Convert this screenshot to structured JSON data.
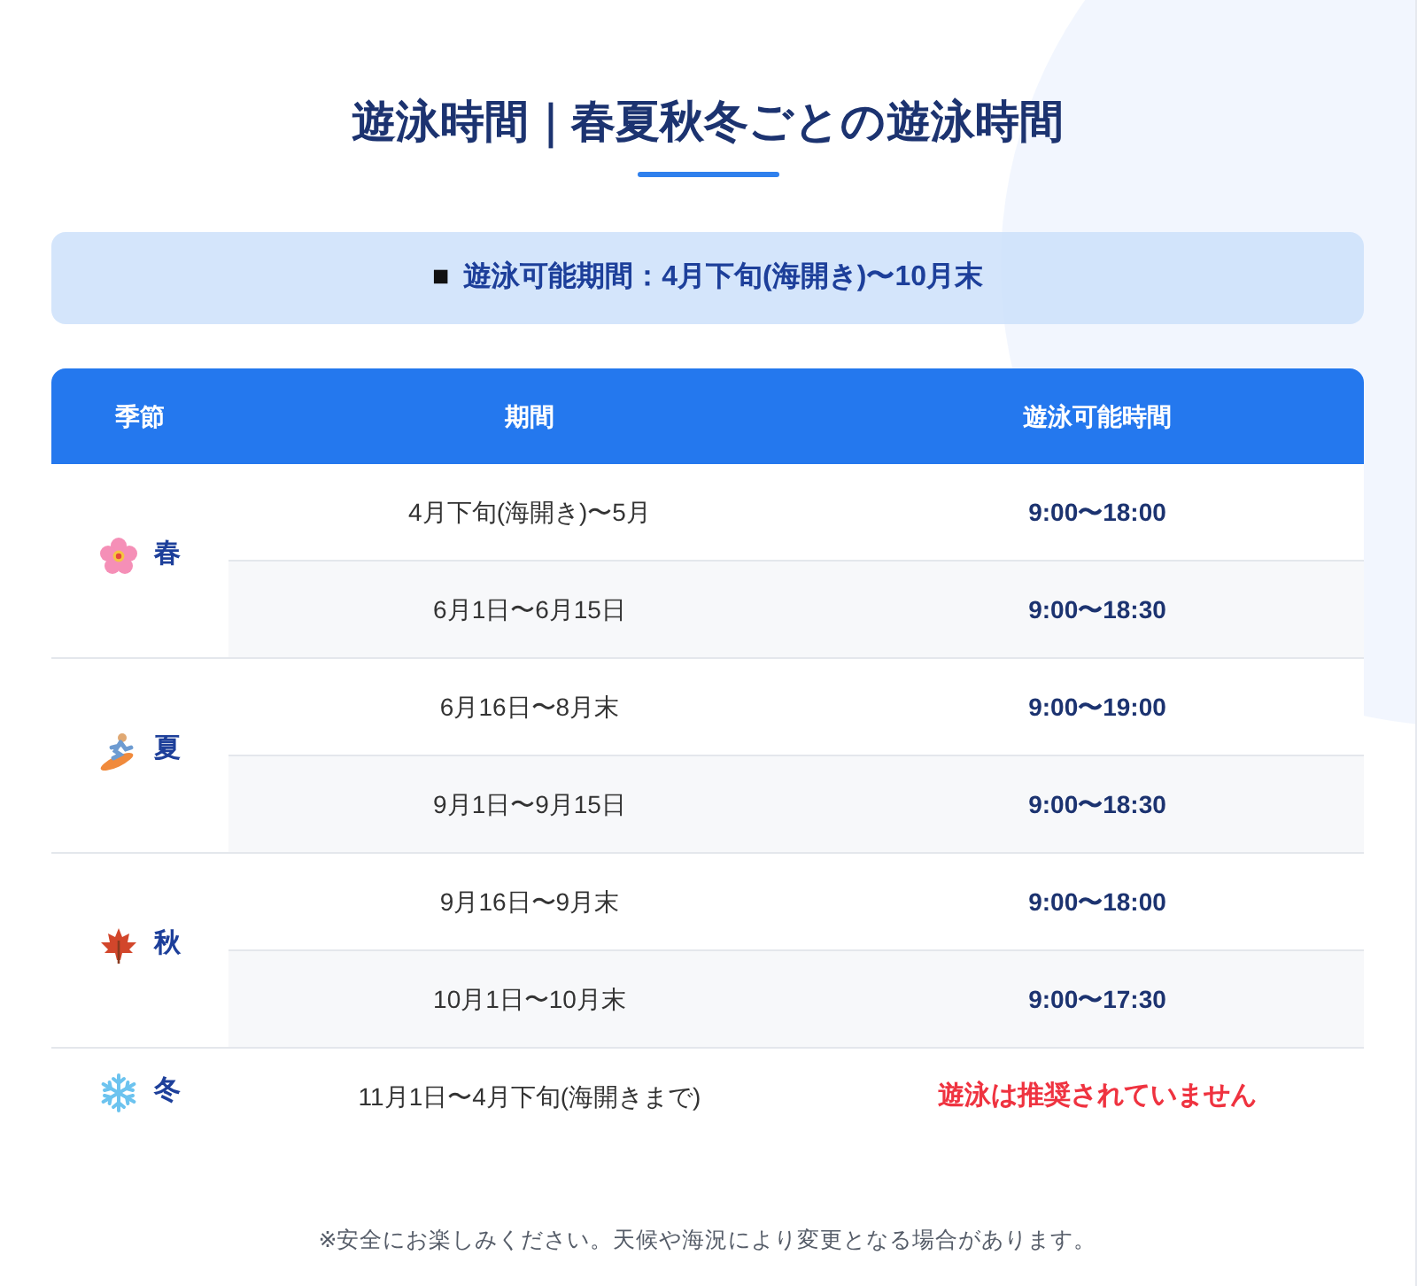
{
  "title": "遊泳時間｜春夏秋冬ごとの遊泳時間",
  "info": {
    "marker": "■",
    "text": "遊泳可能期間：4月下旬(海開き)〜10月末"
  },
  "table": {
    "columns": [
      "季節",
      "期間",
      "遊泳可能時間"
    ],
    "seasons": [
      {
        "label": "春",
        "kind": "spring",
        "periods": [
          {
            "period": "4月下旬(海開き)〜5月",
            "hours": "9:00〜18:00",
            "kind": "time"
          },
          {
            "period": "6月1日〜6月15日",
            "hours": "9:00〜18:30",
            "kind": "time"
          }
        ]
      },
      {
        "label": "夏",
        "kind": "summer",
        "periods": [
          {
            "period": "6月16日〜8月末",
            "hours": "9:00〜19:00",
            "kind": "time"
          },
          {
            "period": "9月1日〜9月15日",
            "hours": "9:00〜18:30",
            "kind": "time"
          }
        ]
      },
      {
        "label": "秋",
        "kind": "autumn",
        "periods": [
          {
            "period": "9月16日〜9月末",
            "hours": "9:00〜18:00",
            "kind": "time"
          },
          {
            "period": "10月1日〜10月末",
            "hours": "9:00〜17:30",
            "kind": "time"
          }
        ]
      },
      {
        "label": "冬",
        "kind": "winter",
        "periods": [
          {
            "period": "11月1日〜4月下旬(海開きまで)",
            "hours": "遊泳は推奨されていません",
            "kind": "warning"
          }
        ]
      }
    ]
  },
  "footnote": "※安全にお楽しみください。天候や海況により変更となる場合があります。"
}
